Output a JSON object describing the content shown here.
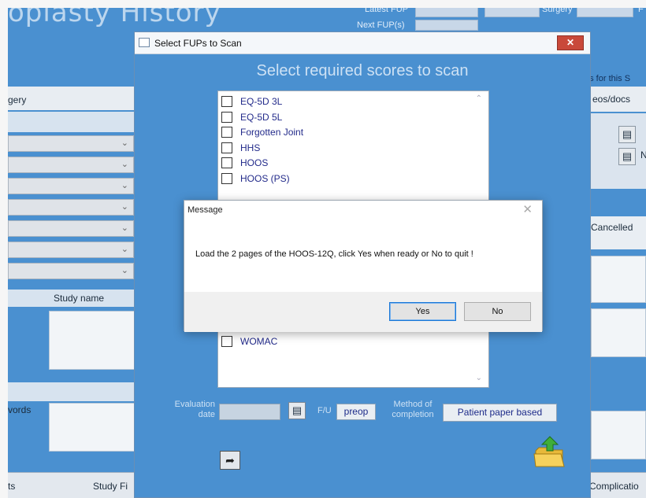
{
  "background": {
    "title_fragment": "oplasty History",
    "header": {
      "latest_fup_label": "Latest FUP",
      "next_fup_label": "Next FUP(s)",
      "surgery_label": "Surgery",
      "right_cut": "F"
    },
    "left": {
      "tab_label": "gery",
      "study_name_label": "Study name",
      "words_label": "vords"
    },
    "right": {
      "for_this_label": "es for this S",
      "videos_docs_label": "eos/docs",
      "n_label": "N",
      "cancelled_label": "Cancelled"
    },
    "bottom": {
      "col1": "ts",
      "col2": "Study Fi",
      "col3": "Complicatio"
    }
  },
  "fup_dialog": {
    "title": "Select FUPs to Scan",
    "close_glyph": "✕",
    "heading": "Select required scores to scan",
    "scores_top": [
      "EQ-5D 3L",
      "EQ-5D 5L",
      "Forgotten Joint",
      "HHS",
      "HOOS",
      "HOOS (PS)"
    ],
    "scores_bottom": [
      "WOMAC"
    ],
    "evaluation_label_1": "Evaluation",
    "evaluation_label_2": "date",
    "evaluation_value": "",
    "fu_label": "F/U",
    "fu_value": "preop",
    "method_label_1": "Method of",
    "method_label_2": "completion",
    "method_value": "Patient paper based"
  },
  "message_box": {
    "title": "Message",
    "close_glyph": "✕",
    "text": "Load the 2 pages of the HOOS-12Q, click Yes when ready or No to quit !",
    "yes_label": "Yes",
    "no_label": "No"
  },
  "colors": {
    "app_blue": "#4a90d0",
    "label_blue": "#222a8a",
    "close_red": "#c9493a"
  }
}
